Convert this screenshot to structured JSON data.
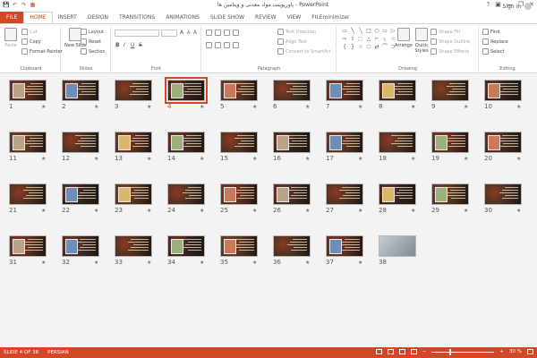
{
  "window": {
    "title": "پاورپوینت مواد معدنی و ویتامین ها  -  PowerPoint",
    "qat": [
      "💾",
      "↶",
      "↷",
      "▦"
    ],
    "controls": [
      "?",
      "▣",
      "—",
      "❐",
      "✕"
    ]
  },
  "tabs": [
    "FILE",
    "HOME",
    "INSERT",
    "DESIGN",
    "TRANSITIONS",
    "ANIMATIONS",
    "SLIDE SHOW",
    "REVIEW",
    "VIEW",
    "FILEminimizer"
  ],
  "active_tab": "HOME",
  "sign_in": "Sign in",
  "ribbon": {
    "clipboard": {
      "label": "Clipboard",
      "paste": "Paste",
      "cut": "Cut",
      "copy": "Copy",
      "format_painter": "Format Painter"
    },
    "slides": {
      "label": "Slides",
      "new_slide": "New Slide",
      "layout": "Layout",
      "reset": "Reset",
      "section": "Section"
    },
    "font": {
      "label": "Font",
      "bold": "B",
      "italic": "I",
      "underline": "U",
      "strike": "S",
      "grow": "A",
      "shrink": "A",
      "clear": "A"
    },
    "paragraph": {
      "label": "Paragraph",
      "text_direction": "Text Direction",
      "align_text": "Align Text",
      "convert": "Convert to SmartArt"
    },
    "drawing": {
      "label": "Drawing",
      "arrange": "Arrange",
      "quick_styles": "Quick Styles",
      "shape_fill": "Shape Fill",
      "shape_outline": "Shape Outline",
      "shape_effects": "Shape Effects",
      "shapes": [
        "▭",
        "╲",
        "╲",
        "□",
        "○",
        "▭",
        "▷",
        "⇨",
        "⇧",
        "⬚",
        "△",
        "⌐",
        "╮",
        "☆",
        "{",
        "}",
        "☆",
        "⬡",
        "⇄",
        "⌒",
        "⊃"
      ]
    },
    "editing": {
      "label": "Editing",
      "find": "Find",
      "replace": "Replace",
      "select": "Select"
    }
  },
  "slides": [
    {
      "n": "1"
    },
    {
      "n": "2"
    },
    {
      "n": "3"
    },
    {
      "n": "4"
    },
    {
      "n": "5"
    },
    {
      "n": "6"
    },
    {
      "n": "7"
    },
    {
      "n": "8"
    },
    {
      "n": "9"
    },
    {
      "n": "10"
    },
    {
      "n": "11"
    },
    {
      "n": "12"
    },
    {
      "n": "13"
    },
    {
      "n": "14"
    },
    {
      "n": "15"
    },
    {
      "n": "16"
    },
    {
      "n": "17"
    },
    {
      "n": "18"
    },
    {
      "n": "19"
    },
    {
      "n": "20"
    },
    {
      "n": "21"
    },
    {
      "n": "22"
    },
    {
      "n": "23"
    },
    {
      "n": "24"
    },
    {
      "n": "25"
    },
    {
      "n": "26"
    },
    {
      "n": "27"
    },
    {
      "n": "28"
    },
    {
      "n": "29"
    },
    {
      "n": "30"
    },
    {
      "n": "31"
    },
    {
      "n": "32"
    },
    {
      "n": "33"
    },
    {
      "n": "34"
    },
    {
      "n": "35"
    },
    {
      "n": "36"
    },
    {
      "n": "37"
    },
    {
      "n": "38"
    }
  ],
  "selected_slide": "4",
  "star": "★",
  "status": {
    "slide": "SLIDE 4 OF 38",
    "language": "PERSIAN",
    "zoom": "30 %",
    "zoom_level": 0.3,
    "minus": "−",
    "plus": "+"
  },
  "colors": {
    "accent": "#d24726",
    "thumb_bg": "#3b2a22"
  }
}
